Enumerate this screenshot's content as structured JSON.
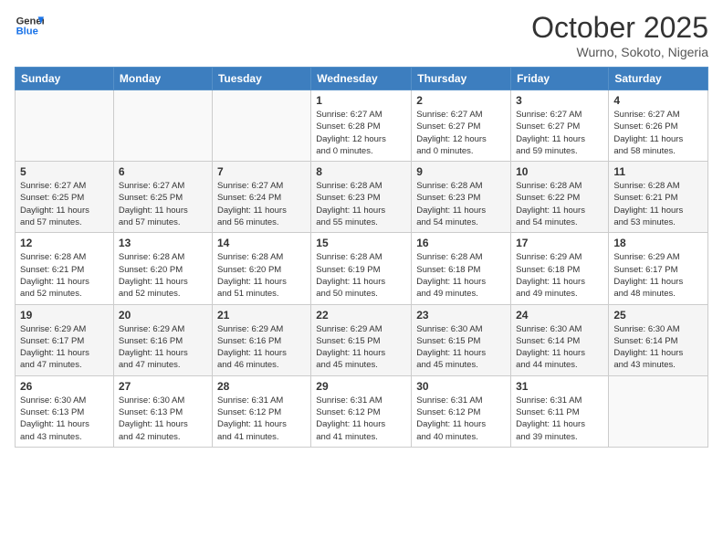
{
  "header": {
    "logo_line1": "General",
    "logo_line2": "Blue",
    "month": "October 2025",
    "location": "Wurno, Sokoto, Nigeria"
  },
  "weekdays": [
    "Sunday",
    "Monday",
    "Tuesday",
    "Wednesday",
    "Thursday",
    "Friday",
    "Saturday"
  ],
  "weeks": [
    [
      {
        "day": "",
        "info": ""
      },
      {
        "day": "",
        "info": ""
      },
      {
        "day": "",
        "info": ""
      },
      {
        "day": "1",
        "info": "Sunrise: 6:27 AM\nSunset: 6:28 PM\nDaylight: 12 hours\nand 0 minutes."
      },
      {
        "day": "2",
        "info": "Sunrise: 6:27 AM\nSunset: 6:27 PM\nDaylight: 12 hours\nand 0 minutes."
      },
      {
        "day": "3",
        "info": "Sunrise: 6:27 AM\nSunset: 6:27 PM\nDaylight: 11 hours\nand 59 minutes."
      },
      {
        "day": "4",
        "info": "Sunrise: 6:27 AM\nSunset: 6:26 PM\nDaylight: 11 hours\nand 58 minutes."
      }
    ],
    [
      {
        "day": "5",
        "info": "Sunrise: 6:27 AM\nSunset: 6:25 PM\nDaylight: 11 hours\nand 57 minutes."
      },
      {
        "day": "6",
        "info": "Sunrise: 6:27 AM\nSunset: 6:25 PM\nDaylight: 11 hours\nand 57 minutes."
      },
      {
        "day": "7",
        "info": "Sunrise: 6:27 AM\nSunset: 6:24 PM\nDaylight: 11 hours\nand 56 minutes."
      },
      {
        "day": "8",
        "info": "Sunrise: 6:28 AM\nSunset: 6:23 PM\nDaylight: 11 hours\nand 55 minutes."
      },
      {
        "day": "9",
        "info": "Sunrise: 6:28 AM\nSunset: 6:23 PM\nDaylight: 11 hours\nand 54 minutes."
      },
      {
        "day": "10",
        "info": "Sunrise: 6:28 AM\nSunset: 6:22 PM\nDaylight: 11 hours\nand 54 minutes."
      },
      {
        "day": "11",
        "info": "Sunrise: 6:28 AM\nSunset: 6:21 PM\nDaylight: 11 hours\nand 53 minutes."
      }
    ],
    [
      {
        "day": "12",
        "info": "Sunrise: 6:28 AM\nSunset: 6:21 PM\nDaylight: 11 hours\nand 52 minutes."
      },
      {
        "day": "13",
        "info": "Sunrise: 6:28 AM\nSunset: 6:20 PM\nDaylight: 11 hours\nand 52 minutes."
      },
      {
        "day": "14",
        "info": "Sunrise: 6:28 AM\nSunset: 6:20 PM\nDaylight: 11 hours\nand 51 minutes."
      },
      {
        "day": "15",
        "info": "Sunrise: 6:28 AM\nSunset: 6:19 PM\nDaylight: 11 hours\nand 50 minutes."
      },
      {
        "day": "16",
        "info": "Sunrise: 6:28 AM\nSunset: 6:18 PM\nDaylight: 11 hours\nand 49 minutes."
      },
      {
        "day": "17",
        "info": "Sunrise: 6:29 AM\nSunset: 6:18 PM\nDaylight: 11 hours\nand 49 minutes."
      },
      {
        "day": "18",
        "info": "Sunrise: 6:29 AM\nSunset: 6:17 PM\nDaylight: 11 hours\nand 48 minutes."
      }
    ],
    [
      {
        "day": "19",
        "info": "Sunrise: 6:29 AM\nSunset: 6:17 PM\nDaylight: 11 hours\nand 47 minutes."
      },
      {
        "day": "20",
        "info": "Sunrise: 6:29 AM\nSunset: 6:16 PM\nDaylight: 11 hours\nand 47 minutes."
      },
      {
        "day": "21",
        "info": "Sunrise: 6:29 AM\nSunset: 6:16 PM\nDaylight: 11 hours\nand 46 minutes."
      },
      {
        "day": "22",
        "info": "Sunrise: 6:29 AM\nSunset: 6:15 PM\nDaylight: 11 hours\nand 45 minutes."
      },
      {
        "day": "23",
        "info": "Sunrise: 6:30 AM\nSunset: 6:15 PM\nDaylight: 11 hours\nand 45 minutes."
      },
      {
        "day": "24",
        "info": "Sunrise: 6:30 AM\nSunset: 6:14 PM\nDaylight: 11 hours\nand 44 minutes."
      },
      {
        "day": "25",
        "info": "Sunrise: 6:30 AM\nSunset: 6:14 PM\nDaylight: 11 hours\nand 43 minutes."
      }
    ],
    [
      {
        "day": "26",
        "info": "Sunrise: 6:30 AM\nSunset: 6:13 PM\nDaylight: 11 hours\nand 43 minutes."
      },
      {
        "day": "27",
        "info": "Sunrise: 6:30 AM\nSunset: 6:13 PM\nDaylight: 11 hours\nand 42 minutes."
      },
      {
        "day": "28",
        "info": "Sunrise: 6:31 AM\nSunset: 6:12 PM\nDaylight: 11 hours\nand 41 minutes."
      },
      {
        "day": "29",
        "info": "Sunrise: 6:31 AM\nSunset: 6:12 PM\nDaylight: 11 hours\nand 41 minutes."
      },
      {
        "day": "30",
        "info": "Sunrise: 6:31 AM\nSunset: 6:12 PM\nDaylight: 11 hours\nand 40 minutes."
      },
      {
        "day": "31",
        "info": "Sunrise: 6:31 AM\nSunset: 6:11 PM\nDaylight: 11 hours\nand 39 minutes."
      },
      {
        "day": "",
        "info": ""
      }
    ]
  ]
}
